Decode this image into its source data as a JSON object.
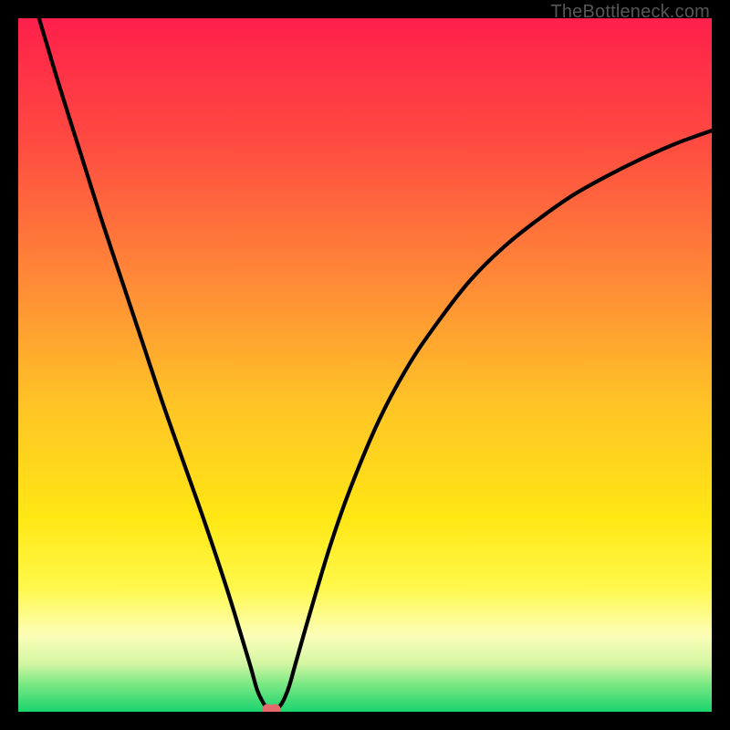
{
  "watermark": "TheBottleneck.com",
  "chart_data": {
    "type": "line",
    "title": "",
    "xlabel": "",
    "ylabel": "",
    "xlim": [
      0,
      100
    ],
    "ylim": [
      0,
      100
    ],
    "gradient_stops": [
      {
        "offset": 0,
        "color": "#ff1f4b"
      },
      {
        "offset": 18,
        "color": "#ff4b41"
      },
      {
        "offset": 38,
        "color": "#ff8a37"
      },
      {
        "offset": 55,
        "color": "#ffc226"
      },
      {
        "offset": 72,
        "color": "#ffe714"
      },
      {
        "offset": 82,
        "color": "#fff84a"
      },
      {
        "offset": 89,
        "color": "#fcfeb8"
      },
      {
        "offset": 93,
        "color": "#d4f6a3"
      },
      {
        "offset": 96,
        "color": "#7be984"
      },
      {
        "offset": 100,
        "color": "#1ad46e"
      }
    ],
    "series": [
      {
        "name": "bottleneck-curve",
        "x": [
          3.0,
          6.0,
          9.0,
          12.0,
          15.0,
          18.0,
          21.0,
          24.0,
          27.0,
          30.0,
          32.0,
          33.5,
          34.5,
          35.5,
          36.0,
          37.0,
          38.0,
          39.0,
          40.0,
          42.0,
          45.0,
          48.0,
          52.0,
          56.0,
          60.0,
          65.0,
          70.0,
          75.0,
          80.0,
          85.0,
          90.0,
          95.0,
          100.0
        ],
        "y": [
          100.0,
          90.0,
          80.5,
          71.0,
          62.0,
          53.0,
          44.0,
          35.5,
          27.0,
          18.0,
          11.5,
          6.5,
          3.0,
          1.0,
          0.3,
          0.3,
          1.2,
          3.5,
          7.0,
          14.0,
          24.0,
          32.5,
          42.0,
          49.5,
          55.5,
          62.0,
          67.0,
          71.0,
          74.5,
          77.3,
          79.8,
          82.0,
          83.8
        ]
      }
    ],
    "marker": {
      "x": 36.5,
      "y": 0.4,
      "color": "#e46a6d"
    }
  }
}
